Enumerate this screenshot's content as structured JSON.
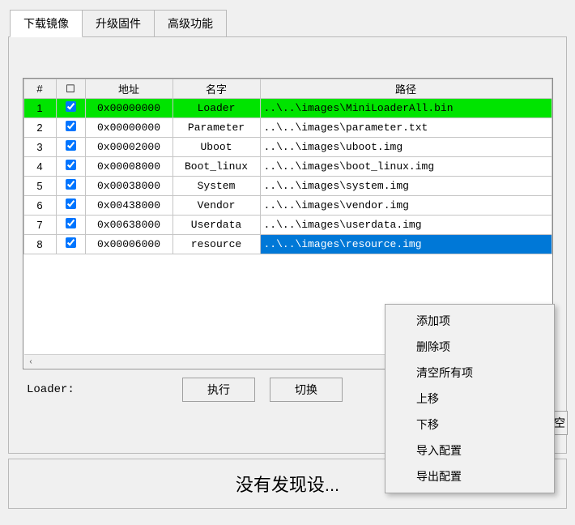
{
  "titlebar": {
    "text_fragment": "…"
  },
  "tabs": [
    {
      "label": "下载镜像",
      "active": true
    },
    {
      "label": "升级固件",
      "active": false
    },
    {
      "label": "高级功能",
      "active": false
    }
  ],
  "columns": {
    "index": "#",
    "check": "☐",
    "addr": "地址",
    "name": "名字",
    "path": "路径"
  },
  "rows": [
    {
      "idx": "1",
      "checked": true,
      "addr": "0x00000000",
      "name": "Loader",
      "path": "..\\..\\images\\MiniLoaderAll.bin",
      "style": "green"
    },
    {
      "idx": "2",
      "checked": true,
      "addr": "0x00000000",
      "name": "Parameter",
      "path": "..\\..\\images\\parameter.txt",
      "style": ""
    },
    {
      "idx": "3",
      "checked": true,
      "addr": "0x00002000",
      "name": "Uboot",
      "path": "..\\..\\images\\uboot.img",
      "style": ""
    },
    {
      "idx": "4",
      "checked": true,
      "addr": "0x00008000",
      "name": "Boot_linux",
      "path": "..\\..\\images\\boot_linux.img",
      "style": ""
    },
    {
      "idx": "5",
      "checked": true,
      "addr": "0x00038000",
      "name": "System",
      "path": "..\\..\\images\\system.img",
      "style": ""
    },
    {
      "idx": "6",
      "checked": true,
      "addr": "0x00438000",
      "name": "Vendor",
      "path": "..\\..\\images\\vendor.img",
      "style": ""
    },
    {
      "idx": "7",
      "checked": true,
      "addr": "0x00638000",
      "name": "Userdata",
      "path": "..\\..\\images\\userdata.img",
      "style": ""
    },
    {
      "idx": "8",
      "checked": true,
      "addr": "0x00006000",
      "name": "resource",
      "path": "..\\..\\images\\resource.img",
      "style": "selected"
    }
  ],
  "loader_label": "Loader:",
  "buttons": {
    "execute": "执行",
    "switch": "切换",
    "clear_fragment": "清空"
  },
  "status": "没有发现设...",
  "context_menu": [
    "添加项",
    "删除项",
    "清空所有项",
    "上移",
    "下移",
    "导入配置",
    "导出配置"
  ],
  "scroll": {
    "left_arrow": "‹",
    "right_arrow": "›"
  }
}
